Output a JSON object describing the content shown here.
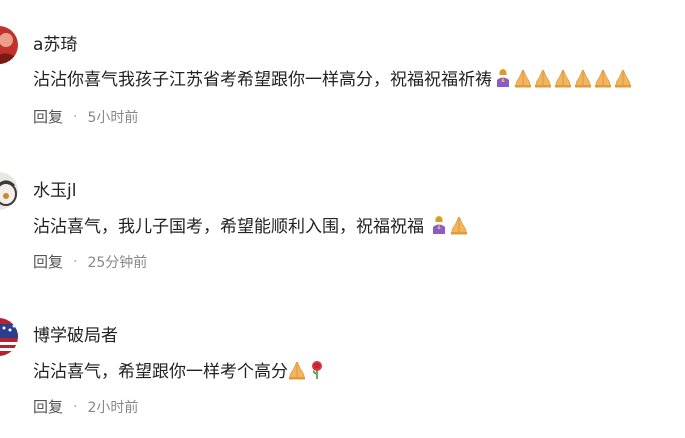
{
  "comments": [
    {
      "username": "a苏琦",
      "text": "沾沾你喜气我孩子江苏省考希望跟你一样高分，祝福祝福祈祷",
      "emojis": [
        "woman-praying-icon",
        "folded-hands-icon",
        "folded-hands-icon",
        "folded-hands-icon",
        "folded-hands-icon",
        "folded-hands-icon",
        "folded-hands-icon"
      ],
      "reply_label": "回复",
      "separator": "·",
      "time": "5小时前",
      "avatar_color": "#c0322b"
    },
    {
      "username": "水玉jl",
      "text": "沾沾喜气，我儿子国考，希望能顺利入围，祝福祝福",
      "emojis": [
        "woman-praying-icon",
        "folded-hands-icon"
      ],
      "reply_label": "回复",
      "separator": "·",
      "time": "25分钟前",
      "avatar_color": "#3a3a3a"
    },
    {
      "username": "博学破局者",
      "text": "沾沾喜气，希望跟你一样考个高分",
      "emojis": [
        "folded-hands-icon",
        "rose-icon"
      ],
      "reply_label": "回复",
      "separator": "·",
      "time": "2小时前",
      "avatar_color": "#b5232f"
    }
  ],
  "colors": {
    "text": "#222222",
    "meta": "#888888",
    "emoji_skin": "#f2b55a",
    "emoji_purple": "#8a5cc8",
    "rose_red": "#e0303a",
    "rose_green": "#3aa045"
  }
}
